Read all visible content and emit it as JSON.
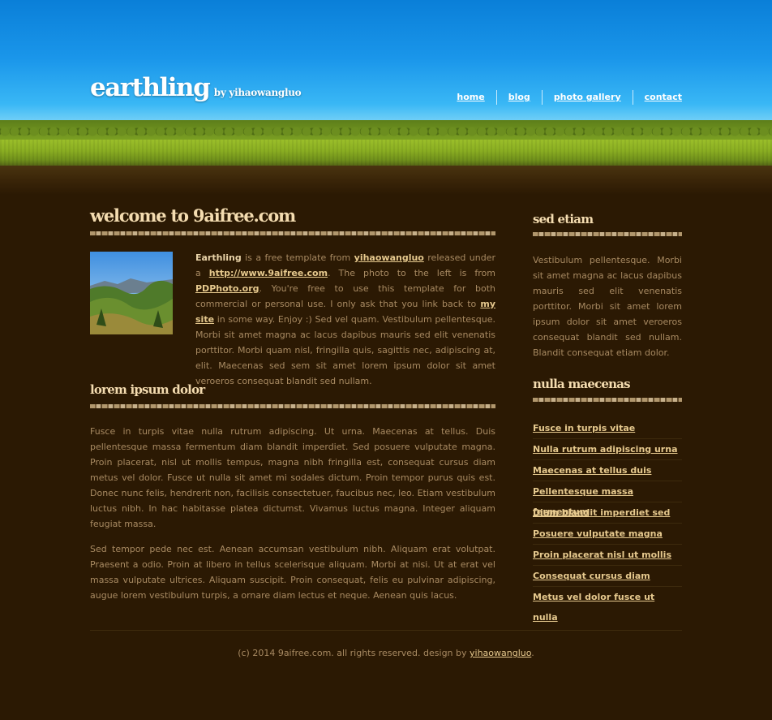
{
  "header": {
    "site_name": "earthling",
    "byline": "by yihaowangluo",
    "nav": [
      {
        "label": "home"
      },
      {
        "label": "blog"
      },
      {
        "label": "photo gallery"
      },
      {
        "label": "contact"
      }
    ]
  },
  "main": {
    "welcome_title": "welcome to 9aifree.com",
    "intro": {
      "t1": "Earthling",
      "t2": " is a free template from ",
      "t3": "yihaowangluo",
      "t4": " released under a ",
      "t5": "http://www.9aifree.com",
      "t6": ". The photo to the left is from ",
      "t7": "PDPhoto.org",
      "t8": ". You're free to use this template for both commercial or personal use. I only ask that you link back to ",
      "t9": "my site",
      "t10": " in some way. Enjoy :) Sed vel quam. Vestibulum pellentesque. Morbi sit amet magna ac lacus dapibus mauris sed elit venenatis porttitor. Morbi quam nisl, fringilla quis, sagittis nec, adipiscing at, elit. Maecenas sed sem sit amet lorem ipsum dolor sit amet veroeros consequat blandit sed nullam."
    },
    "section2_title": "lorem ipsum dolor",
    "paragraph1": "Fusce in turpis vitae nulla rutrum adipiscing. Ut urna. Maecenas at tellus. Duis pellentesque massa fermentum diam blandit imperdiet. Sed posuere vulputate magna. Proin placerat, nisl ut mollis tempus, magna nibh fringilla est, consequat cursus diam metus vel dolor. Fusce ut nulla sit amet mi sodales dictum. Proin tempor purus quis est. Donec nunc felis, hendrerit non, facilisis consectetuer, faucibus nec, leo. Etiam vestibulum luctus nibh. In hac habitasse platea dictumst. Vivamus luctus magna. Integer aliquam feugiat massa.",
    "paragraph2": "Sed tempor pede nec est. Aenean accumsan vestibulum nibh. Aliquam erat volutpat. Praesent a odio. Proin at libero in tellus scelerisque aliquam. Morbi at nisi. Ut at erat vel massa vulputate ultrices. Aliquam suscipit. Proin consequat, felis eu pulvinar adipiscing, augue lorem vestibulum turpis, a ornare diam lectus et neque. Aenean quis lacus."
  },
  "sidebar": {
    "box1_title": "sed etiam",
    "box1_text": "Vestibulum pellentesque. Morbi sit amet magna ac lacus dapibus mauris sed elit venenatis porttitor. Morbi sit amet lorem ipsum dolor sit amet veroeros consequat blandit sed nullam. Blandit consequat etiam dolor.",
    "box2_title": "nulla maecenas",
    "links": [
      {
        "label": "Fusce in turpis vitae"
      },
      {
        "label": "Nulla rutrum adipiscing urna"
      },
      {
        "label": "Maecenas at tellus duis"
      },
      {
        "label": "Pellentesque massa fermentum"
      },
      {
        "label": "Diam blandit imperdiet sed"
      },
      {
        "label": "Posuere vulputate magna"
      },
      {
        "label": "Proin placerat nisl ut mollis"
      },
      {
        "label": "Consequat cursus diam"
      },
      {
        "label": "Metus vel dolor fusce ut nulla"
      }
    ]
  },
  "footer": {
    "text": "(c) 2014 9aifree.com. all rights reserved. design by ",
    "link": "yihaowangluo",
    "suffix": "."
  },
  "colors": {
    "background": "#2b1903",
    "heading": "#f4dcb0",
    "body_text": "#a88a62",
    "link": "#e6c98e",
    "sky": "#1a96ea",
    "grass": "#8aae22"
  }
}
